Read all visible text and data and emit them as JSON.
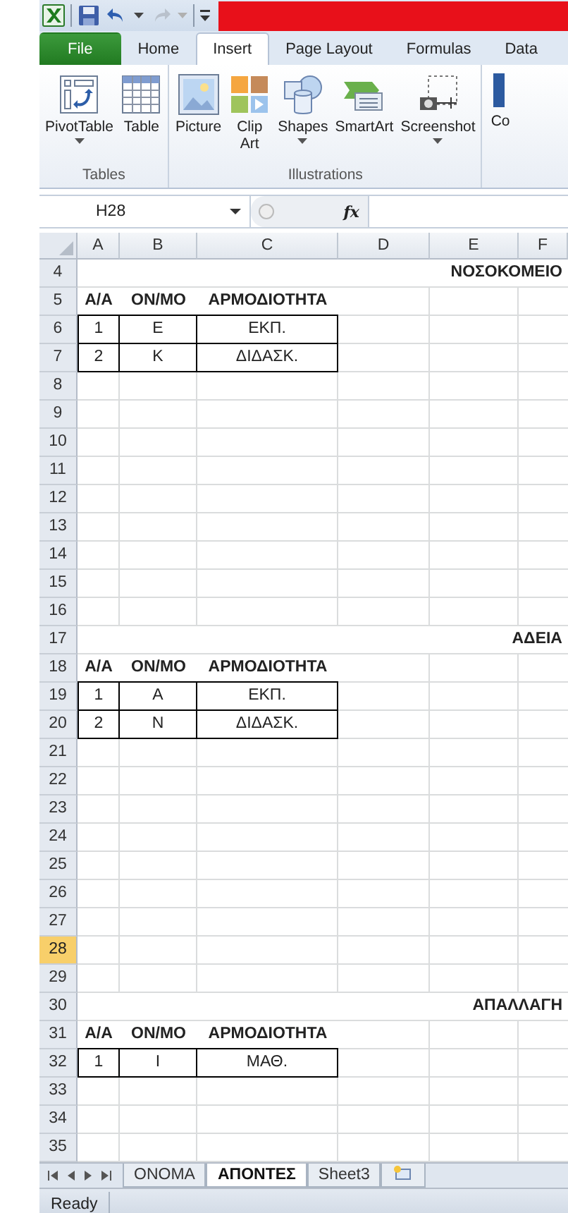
{
  "ribbon_tabs": [
    {
      "label": "File",
      "kind": "file",
      "selected": false
    },
    {
      "label": "Home",
      "kind": "tab",
      "selected": false
    },
    {
      "label": "Insert",
      "kind": "tab",
      "selected": true
    },
    {
      "label": "Page Layout",
      "kind": "tab",
      "selected": false
    },
    {
      "label": "Formulas",
      "kind": "tab",
      "selected": false
    },
    {
      "label": "Data",
      "kind": "tab",
      "selected": false
    }
  ],
  "ribbon_groups": [
    {
      "label": "Tables",
      "commands": [
        {
          "label": "PivotTable",
          "dropdown": true
        },
        {
          "label": "Table",
          "dropdown": false
        }
      ]
    },
    {
      "label": "Illustrations",
      "commands": [
        {
          "label": "Picture",
          "dropdown": false
        },
        {
          "label": "Clip Art",
          "dropdown": false
        },
        {
          "label": "Shapes",
          "dropdown": true
        },
        {
          "label": "SmartArt",
          "dropdown": false
        },
        {
          "label": "Screenshot",
          "dropdown": true
        }
      ]
    }
  ],
  "ribbon_cut_label": "Co",
  "name_box": "H28",
  "formula_label": "fx",
  "columns": [
    "A",
    "B",
    "C",
    "D",
    "E",
    "F"
  ],
  "rows": [
    {
      "number": "4",
      "selected": false,
      "kind": "title",
      "title": "ΝΟΣΟΚΟΜΕΙΟ"
    },
    {
      "number": "5",
      "selected": false,
      "kind": "header",
      "cells": [
        "Α/Α",
        "ΟΝ/ΜΟ",
        "ΑΡΜΟΔΙΟΤΗΤΑ"
      ]
    },
    {
      "number": "6",
      "selected": false,
      "kind": "data",
      "cells": [
        "1",
        "Ε",
        "ΕΚΠ."
      ]
    },
    {
      "number": "7",
      "selected": false,
      "kind": "data",
      "cells": [
        "2",
        "Κ",
        "ΔΙΔΑΣΚ."
      ]
    },
    {
      "number": "8",
      "selected": false,
      "kind": "empty"
    },
    {
      "number": "9",
      "selected": false,
      "kind": "empty"
    },
    {
      "number": "10",
      "selected": false,
      "kind": "empty"
    },
    {
      "number": "11",
      "selected": false,
      "kind": "empty"
    },
    {
      "number": "12",
      "selected": false,
      "kind": "empty"
    },
    {
      "number": "13",
      "selected": false,
      "kind": "empty"
    },
    {
      "number": "14",
      "selected": false,
      "kind": "empty"
    },
    {
      "number": "15",
      "selected": false,
      "kind": "empty"
    },
    {
      "number": "16",
      "selected": false,
      "kind": "empty"
    },
    {
      "number": "17",
      "selected": false,
      "kind": "title",
      "title": "ΑΔΕΙΑ"
    },
    {
      "number": "18",
      "selected": false,
      "kind": "header",
      "cells": [
        "Α/Α",
        "ΟΝ/ΜΟ",
        "ΑΡΜΟΔΙΟΤΗΤΑ"
      ]
    },
    {
      "number": "19",
      "selected": false,
      "kind": "data",
      "cells": [
        "1",
        "Α",
        "ΕΚΠ."
      ]
    },
    {
      "number": "20",
      "selected": false,
      "kind": "data",
      "cells": [
        "2",
        "Ν",
        "ΔΙΔΑΣΚ."
      ]
    },
    {
      "number": "21",
      "selected": false,
      "kind": "empty"
    },
    {
      "number": "22",
      "selected": false,
      "kind": "empty"
    },
    {
      "number": "23",
      "selected": false,
      "kind": "empty"
    },
    {
      "number": "24",
      "selected": false,
      "kind": "empty"
    },
    {
      "number": "25",
      "selected": false,
      "kind": "empty"
    },
    {
      "number": "26",
      "selected": false,
      "kind": "empty"
    },
    {
      "number": "27",
      "selected": false,
      "kind": "empty"
    },
    {
      "number": "28",
      "selected": true,
      "kind": "empty"
    },
    {
      "number": "29",
      "selected": false,
      "kind": "empty"
    },
    {
      "number": "30",
      "selected": false,
      "kind": "title",
      "title": "ΑΠΑΛΛΑΓΗ"
    },
    {
      "number": "31",
      "selected": false,
      "kind": "header",
      "cells": [
        "Α/Α",
        "ΟΝ/ΜΟ",
        "ΑΡΜΟΔΙΟΤΗΤΑ"
      ]
    },
    {
      "number": "32",
      "selected": false,
      "kind": "data",
      "cells": [
        "1",
        "Ι",
        "ΜΑΘ."
      ]
    },
    {
      "number": "33",
      "selected": false,
      "kind": "empty"
    },
    {
      "number": "34",
      "selected": false,
      "kind": "empty"
    },
    {
      "number": "35",
      "selected": false,
      "kind": "empty"
    }
  ],
  "sheet_tabs": [
    {
      "label": "ΟΝΟΜΑ",
      "selected": false
    },
    {
      "label": "ΑΠΟΝΤΕΣ",
      "selected": true
    },
    {
      "label": "Sheet3",
      "selected": false
    }
  ],
  "status": "Ready"
}
